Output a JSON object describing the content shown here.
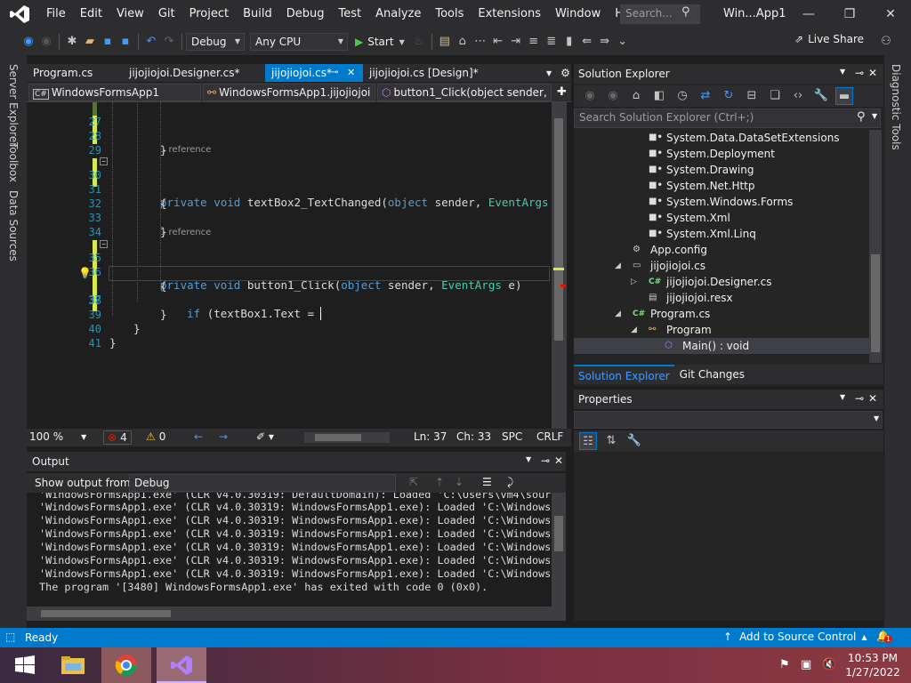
{
  "window": {
    "title": "Win...App1",
    "menu": [
      "File",
      "Edit",
      "View",
      "Git",
      "Project",
      "Build",
      "Debug",
      "Test",
      "Analyze",
      "Tools",
      "Extensions",
      "Window",
      "Help"
    ],
    "search_placeholder": "Search..."
  },
  "toolbar": {
    "config": "Debug",
    "platform": "Any CPU",
    "start_label": "Start",
    "live_share": "Live Share"
  },
  "side_tabs_left": [
    "Server Explorer",
    "Toolbox",
    "Data Sources"
  ],
  "side_tabs_right": [
    "Diagnostic Tools"
  ],
  "doc_tabs": [
    {
      "label": "Program.cs",
      "active": false
    },
    {
      "label": "jijojiojoi.Designer.cs*",
      "active": false
    },
    {
      "label": "jijojiojoi.cs*",
      "active": true
    },
    {
      "label": "jijojiojoi.cs [Design]*",
      "active": false
    }
  ],
  "navbar": {
    "project": "WindowsFormsApp1",
    "class": "WindowsFormsApp1.jijojiojoi",
    "member": "button1_Click(object sender, E"
  },
  "code": {
    "lines": [
      {
        "n": "27",
        "text": "",
        "ref": ""
      },
      {
        "n": "28",
        "text": "}",
        "ref": ""
      },
      {
        "n": "29",
        "text": "",
        "ref": ""
      },
      {
        "n": "30",
        "text": "private void textBox2_TextChanged(object sender, EventArgs e)",
        "ref": "1 reference"
      },
      {
        "n": "31",
        "text": "{",
        "ref": ""
      },
      {
        "n": "32",
        "text": "",
        "ref": ""
      },
      {
        "n": "33",
        "text": "}",
        "ref": ""
      },
      {
        "n": "34",
        "text": "",
        "ref": ""
      },
      {
        "n": "35",
        "text": "private void button1_Click(object sender, EventArgs e)",
        "ref": "1 reference"
      },
      {
        "n": "36",
        "text": "{",
        "ref": ""
      },
      {
        "n": "37",
        "text": "    if (textBox1.Text = ",
        "ref": ""
      },
      {
        "n": "38",
        "text": "}",
        "ref": ""
      },
      {
        "n": "39",
        "text": "}",
        "ref": ""
      },
      {
        "n": "40",
        "text": "}",
        "ref": ""
      },
      {
        "n": "41",
        "text": "",
        "ref": ""
      }
    ]
  },
  "editor_status": {
    "zoom": "100 %",
    "errors": "4",
    "warnings": "0",
    "line": "Ln: 37",
    "col": "Ch: 33",
    "spc": "SPC",
    "eol": "CRLF"
  },
  "output": {
    "title": "Output",
    "show_from_label": "Show output from:",
    "source": "Debug",
    "lines": [
      "'WindowsFormsApp1.exe' (CLR v4.0.30319: DefaultDomain): Loaded 'C:\\Users\\vm4\\source",
      "'WindowsFormsApp1.exe' (CLR v4.0.30319: WindowsFormsApp1.exe): Loaded 'C:\\Windows\\",
      "'WindowsFormsApp1.exe' (CLR v4.0.30319: WindowsFormsApp1.exe): Loaded 'C:\\Windows\\",
      "'WindowsFormsApp1.exe' (CLR v4.0.30319: WindowsFormsApp1.exe): Loaded 'C:\\Windows\\",
      "'WindowsFormsApp1.exe' (CLR v4.0.30319: WindowsFormsApp1.exe): Loaded 'C:\\Windows\\",
      "'WindowsFormsApp1.exe' (CLR v4.0.30319: WindowsFormsApp1.exe): Loaded 'C:\\Windows\\",
      "'WindowsFormsApp1.exe' (CLR v4.0.30319: WindowsFormsApp1.exe): Loaded 'C:\\Windows\\",
      "The program '[3480] WindowsFormsApp1.exe' has exited with code 0 (0x0)."
    ]
  },
  "solution_explorer": {
    "title": "Solution Explorer",
    "search_placeholder": "Search Solution Explorer (Ctrl+;)",
    "nodes": [
      {
        "label": "System.Data.DataSetExtensions",
        "icon": "reference-icon",
        "depth": 3,
        "expander": ""
      },
      {
        "label": "System.Deployment",
        "icon": "reference-icon",
        "depth": 3,
        "expander": ""
      },
      {
        "label": "System.Drawing",
        "icon": "reference-icon",
        "depth": 3,
        "expander": ""
      },
      {
        "label": "System.Net.Http",
        "icon": "reference-icon",
        "depth": 3,
        "expander": ""
      },
      {
        "label": "System.Windows.Forms",
        "icon": "reference-icon",
        "depth": 3,
        "expander": ""
      },
      {
        "label": "System.Xml",
        "icon": "reference-icon",
        "depth": 3,
        "expander": ""
      },
      {
        "label": "System.Xml.Linq",
        "icon": "reference-icon",
        "depth": 3,
        "expander": ""
      },
      {
        "label": "App.config",
        "icon": "config-icon",
        "depth": 2,
        "expander": ""
      },
      {
        "label": "jijojiojoi.cs",
        "icon": "form-icon",
        "depth": 2,
        "expander": "◢"
      },
      {
        "label": "jijojiojoi.Designer.cs",
        "icon": "cs-file-icon",
        "depth": 3,
        "expander": "▷"
      },
      {
        "label": "jijojiojoi.resx",
        "icon": "resx-icon",
        "depth": 3,
        "expander": ""
      },
      {
        "label": "Program.cs",
        "icon": "cs-file-icon",
        "depth": 2,
        "expander": "◢"
      },
      {
        "label": "Program",
        "icon": "class-icon",
        "depth": 3,
        "expander": "◢"
      },
      {
        "label": "Main() : void",
        "icon": "method-icon",
        "depth": 4,
        "expander": ""
      }
    ],
    "tabs": [
      "Solution Explorer",
      "Git Changes"
    ]
  },
  "properties": {
    "title": "Properties"
  },
  "statusbar": {
    "ready": "Ready",
    "source_control": "Add to Source Control",
    "notifications": "1"
  },
  "taskbar": {
    "time": "10:53 PM",
    "date": "1/27/2022"
  },
  "colors": {
    "accent": "#007acc",
    "background": "#1e1e1e",
    "chrome": "#2d2d30"
  }
}
